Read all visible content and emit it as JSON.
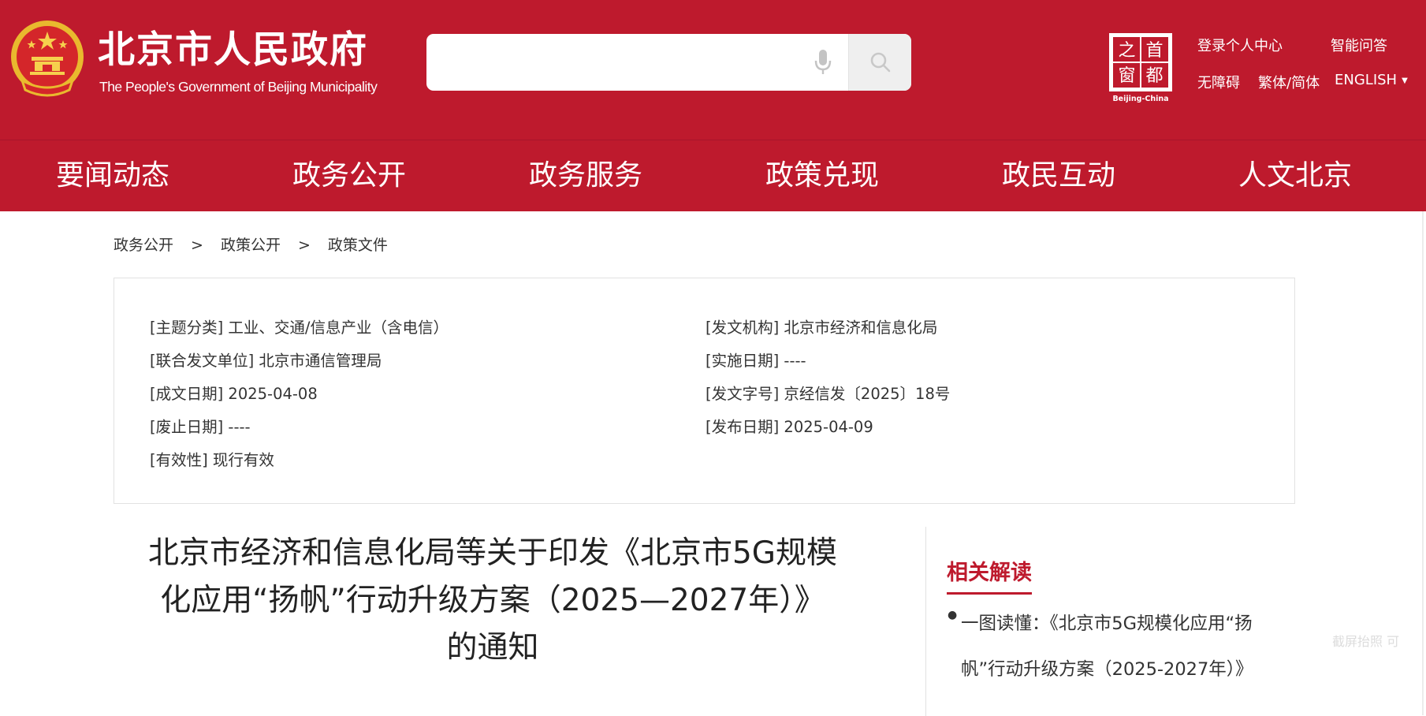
{
  "header": {
    "title": "北京市人民政府",
    "subtitle": "The People's Government of Beijing Municipality",
    "search": {
      "placeholder": ""
    },
    "links": {
      "login": "登录个人中心",
      "qa": "智能问答",
      "accessibility": "无障碍",
      "traditional_simplified": "繁体/简体",
      "english": "ENGLISH"
    },
    "capital_logo": {
      "chars": [
        "之",
        "首",
        "窗",
        "都"
      ],
      "caption": "Beijing-China"
    }
  },
  "nav": {
    "items": [
      "要闻动态",
      "政务公开",
      "政务服务",
      "政策兑现",
      "政民互动",
      "人文北京"
    ]
  },
  "breadcrumb": [
    "政务公开",
    "政策公开",
    "政策文件"
  ],
  "breadcrumb_separator": ">",
  "info": {
    "topic": "[主题分类] 工业、交通/信息产业（含电信）",
    "issuer": "[发文机构] 北京市经济和信息化局",
    "joint_issuer": "[联合发文单位] 北京市通信管理局",
    "effective_date": "[实施日期] ----",
    "written_date": "[成文日期] 2025-04-08",
    "doc_number": "[发文字号] 京经信发〔2025〕18号",
    "repeal_date": "[废止日期] ----",
    "publish_date": "[发布日期] 2025-04-09",
    "validity": "[有效性] 现行有效"
  },
  "article": {
    "title_line1": "北京市经济和信息化局等关于印发《北京市5G规模",
    "title_line2": "化应用“扬帆”行动升级方案（2025—2027年）》",
    "title_line3": "的通知"
  },
  "sidebar": {
    "related_title": "相关解读",
    "items": [
      "一图读懂：《北京市5G规模化应用“扬帆”行动升级方案（2025-2027年）》"
    ]
  },
  "watermark": "截屏抬照 可",
  "colors": {
    "brand_red": "#be1a2d",
    "border": "#e2e2e2"
  }
}
